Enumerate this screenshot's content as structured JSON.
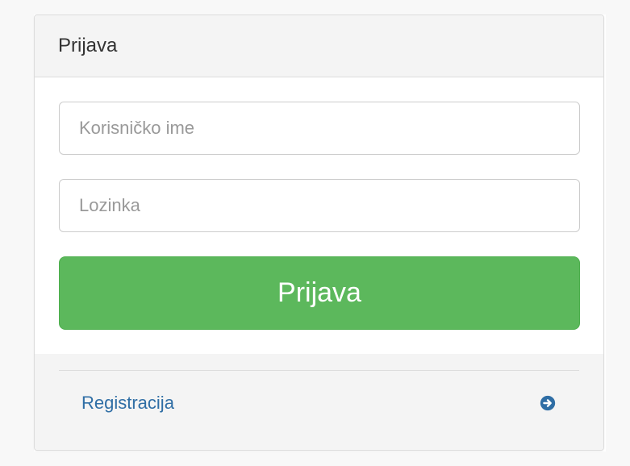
{
  "login_panel": {
    "heading": "Prijava",
    "username_placeholder": "Korisničko ime",
    "password_placeholder": "Lozinka",
    "submit_label": "Prijava",
    "register_label": "Registracija",
    "register_icon": "arrow-right-circle-icon"
  },
  "colors": {
    "button_green": "#5cb85c",
    "link_blue": "#2f6ea5",
    "panel_gray": "#f4f4f4"
  }
}
